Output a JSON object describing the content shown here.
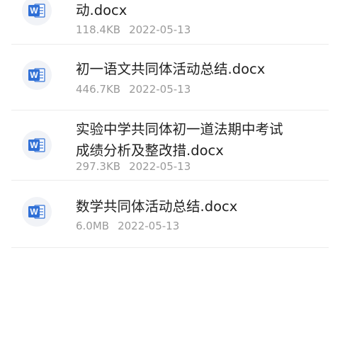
{
  "files": [
    {
      "name_lines": [
        "动.docx"
      ],
      "size": "118.4KB",
      "date": "2022-05-13",
      "icon": "word-doc-icon"
    },
    {
      "name_lines": [
        "初一语文共同体活动总结.docx"
      ],
      "size": "446.7KB",
      "date": "2022-05-13",
      "icon": "word-doc-icon"
    },
    {
      "name_lines": [
        "实验中学共同体初一道法期中考试",
        "成绩分析及整改措.docx"
      ],
      "size": "297.3KB",
      "date": "2022-05-13",
      "icon": "word-doc-icon"
    },
    {
      "name_lines": [
        "数学共同体活动总结.docx"
      ],
      "size": "6.0MB",
      "date": "2022-05-13",
      "icon": "word-doc-icon"
    }
  ],
  "colors": {
    "word_blue": "#2f6fd6",
    "word_blue_dark": "#1f56b3",
    "text": "#222222",
    "meta": "#9a9a9a",
    "divider": "#ececec"
  }
}
